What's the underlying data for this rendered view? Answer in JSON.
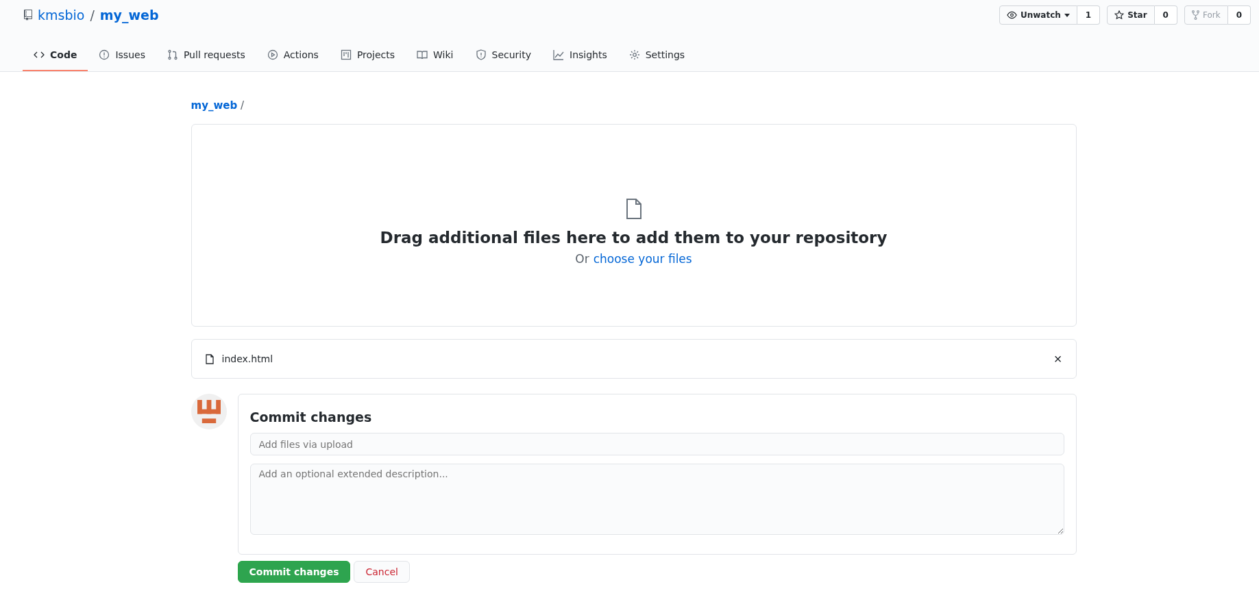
{
  "repo": {
    "owner": "kmsbio",
    "separator": "/",
    "name": "my_web"
  },
  "actions": [
    {
      "label": "Unwatch",
      "count": "1",
      "dropdown": true,
      "disabled": false
    },
    {
      "label": "Star",
      "count": "0",
      "dropdown": false,
      "disabled": false
    },
    {
      "label": "Fork",
      "count": "0",
      "dropdown": false,
      "disabled": true
    }
  ],
  "tabs": [
    {
      "label": "Code",
      "selected": true
    },
    {
      "label": "Issues",
      "selected": false
    },
    {
      "label": "Pull requests",
      "selected": false
    },
    {
      "label": "Actions",
      "selected": false
    },
    {
      "label": "Projects",
      "selected": false
    },
    {
      "label": "Wiki",
      "selected": false
    },
    {
      "label": "Security",
      "selected": false
    },
    {
      "label": "Insights",
      "selected": false
    },
    {
      "label": "Settings",
      "selected": false
    }
  ],
  "breadcrumb": {
    "path": "my_web",
    "separator": "/"
  },
  "dropzone": {
    "title": "Drag additional files here to add them to your repository",
    "prefix": "Or",
    "link": "choose your files"
  },
  "files": [
    {
      "name": "index.html",
      "remove": "×"
    }
  ],
  "commit": {
    "title": "Commit changes",
    "summary_placeholder": "Add files via upload",
    "description_placeholder": "Add an optional extended description...",
    "submit": "Commit changes",
    "cancel": "Cancel"
  }
}
